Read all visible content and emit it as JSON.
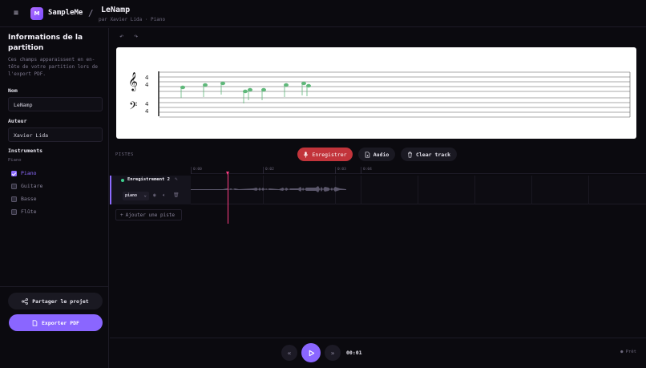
{
  "header": {
    "logo_letter": "M",
    "app_name": "SampleMe",
    "separator": "/",
    "song_title": "LeNamp",
    "song_subtitle": "par Xavier Lida · Piano",
    "menu_icon": "hamburger-icon"
  },
  "sidebar": {
    "title": "Informations de la partition",
    "description": "Ces champs apparaissent en en-tête de votre partition lors de l'export PDF.",
    "name_label": "Nom",
    "name_value": "LeNamp",
    "author_label": "Auteur",
    "author_value": "Xavier Lida",
    "instruments_label": "Instruments",
    "instruments_sub": "Piano",
    "instruments": [
      {
        "label": "Piano",
        "checked": true
      },
      {
        "label": "Guitare",
        "checked": false
      },
      {
        "label": "Basse",
        "checked": false
      },
      {
        "label": "Flûte",
        "checked": false
      }
    ],
    "share_label": "Partager le projet",
    "export_label": "Exporter PDF"
  },
  "score": {
    "time_signature_top": "4",
    "time_signature_bottom": "4",
    "note_color": "#5fb87a"
  },
  "tracks": {
    "section_label": "PISTES",
    "record_label": "Enregistrer",
    "audio_label": "Audio",
    "clear_label": "Clear track",
    "ruler_ticks": [
      "0:00",
      "0:02",
      "0:03",
      "0:04"
    ],
    "track_name": "Enregistrement 2",
    "track_instrument": "piano",
    "add_track_label": "Ajouter une piste"
  },
  "transport": {
    "time": "00:01",
    "status": "● Prêt"
  },
  "colors": {
    "accent": "#8a66ff",
    "record": "#c2343b",
    "playhead": "#ff3d84",
    "track_dot": "#3ecf8e"
  }
}
